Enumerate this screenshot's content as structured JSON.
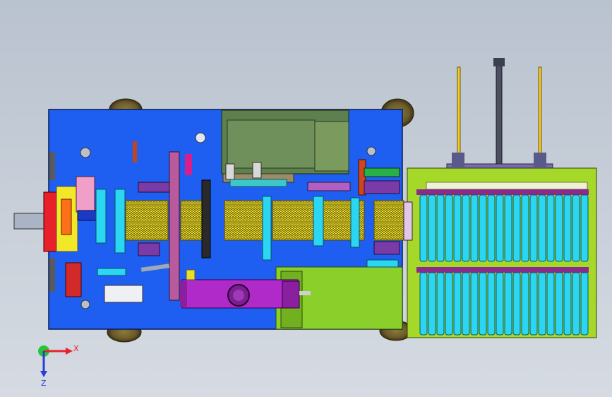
{
  "triad": {
    "x_label": "X",
    "z_label": "Z",
    "x_color": "#e8202a",
    "z_color": "#2b3bd6",
    "y_color": "#27c43a"
  },
  "colors": {
    "base_plate": "#1e5ff2",
    "tray_green": "#a6d82a",
    "tray_cells": "#2ad6f2",
    "dark_panel": "#5e7f4e",
    "cylinder": "#b02ac9",
    "spring": "#f2ea28",
    "wheel": "#6b5a2a"
  }
}
